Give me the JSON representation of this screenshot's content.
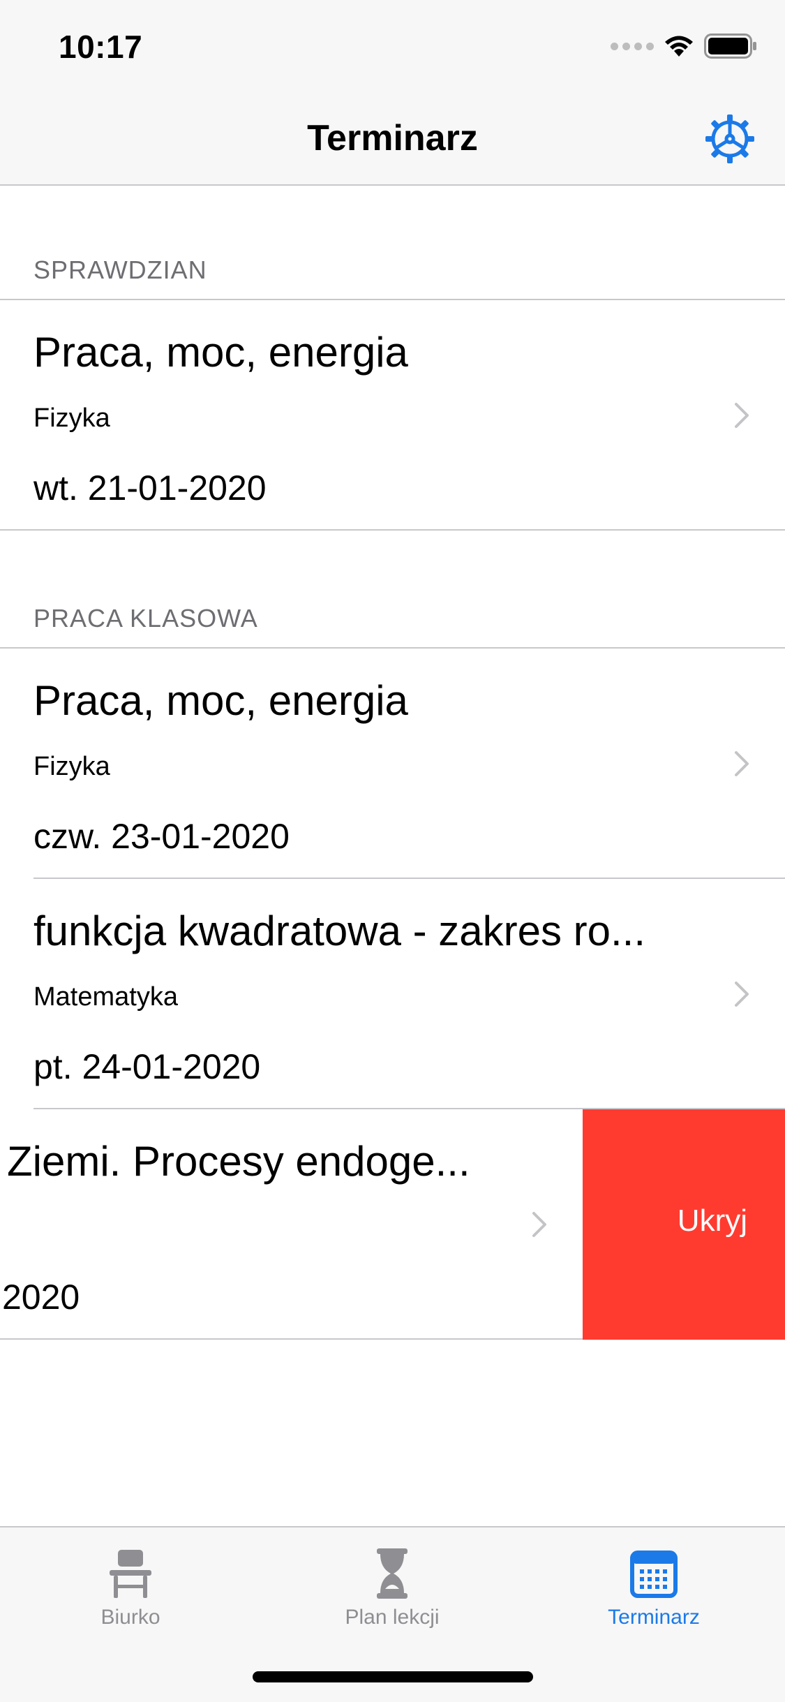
{
  "status_bar": {
    "time": "10:17"
  },
  "nav": {
    "title": "Terminarz",
    "settings_icon": "gear-icon"
  },
  "sections": [
    {
      "header": "SPRAWDZIAN",
      "items": [
        {
          "title": "Praca, moc, energia",
          "subject": "Fizyka",
          "date": "wt. 21-01-2020"
        }
      ]
    },
    {
      "header": "PRACA KLASOWA",
      "items": [
        {
          "title": "Praca, moc, energia",
          "subject": "Fizyka",
          "date": "czw. 23-01-2020"
        },
        {
          "title": "funkcja kwadratowa - zakres ro...",
          "subject": "Matematyka",
          "date": "pt. 24-01-2020"
        },
        {
          "title": "Ziemi. Procesy endoge...",
          "subject": "",
          "date": "2020",
          "swipe_action": "Ukryj"
        }
      ]
    }
  ],
  "tab_bar": {
    "tabs": [
      {
        "label": "Biurko",
        "icon": "desk-icon",
        "active": false
      },
      {
        "label": "Plan lekcji",
        "icon": "hourglass-icon",
        "active": false
      },
      {
        "label": "Terminarz",
        "icon": "calendar-icon",
        "active": true
      }
    ]
  },
  "colors": {
    "accent": "#1b7ae8",
    "destructive": "#ff3b30",
    "secondary_text": "#6d6d72",
    "separator": "#c8c7cc",
    "inactive_tab": "#8e8e93"
  }
}
